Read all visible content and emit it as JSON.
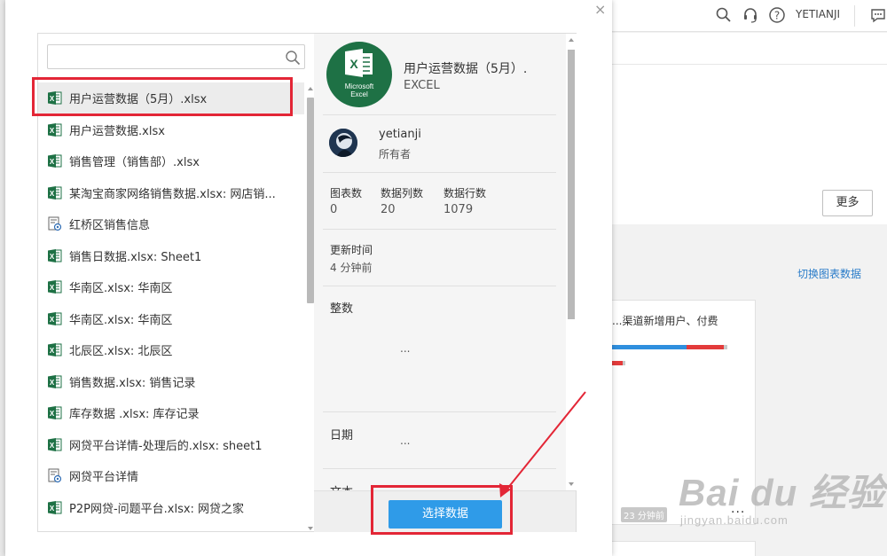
{
  "topbar": {
    "user_name": "YETIANJI",
    "icons": [
      "search-icon",
      "headset-icon",
      "help-icon",
      "chat-icon"
    ]
  },
  "background": {
    "more_button": "更多",
    "switch_link": "切换图表数据",
    "card_title": "渠道新增用户、付费...",
    "card_time": "23 分钟前",
    "card_more": "...",
    "watermark_logo": "Bai du 经验",
    "watermark_url": "jingyan.baidu.com"
  },
  "dialog": {
    "close_label": "×",
    "search": {
      "value": "",
      "placeholder": ""
    },
    "files": [
      {
        "name": "用户运营数据（5月）.xlsx",
        "icon": "excel-icon",
        "selected": true
      },
      {
        "name": "用户运营数据.xlsx",
        "icon": "excel-icon"
      },
      {
        "name": "销售管理（销售部）.xlsx",
        "icon": "excel-icon"
      },
      {
        "name": "某淘宝商家网络销售数据.xlsx: 网店销...",
        "icon": "excel-icon"
      },
      {
        "name": "红桥区销售信息",
        "icon": "database-icon"
      },
      {
        "name": "销售日数据.xlsx: Sheet1",
        "icon": "excel-icon"
      },
      {
        "name": "华南区.xlsx: 华南区",
        "icon": "excel-icon"
      },
      {
        "name": "华南区.xlsx: 华南区",
        "icon": "excel-icon"
      },
      {
        "name": "北辰区.xlsx: 北辰区",
        "icon": "excel-icon"
      },
      {
        "name": "销售数据.xlsx: 销售记录",
        "icon": "excel-icon"
      },
      {
        "name": "库存数据 .xlsx: 库存记录",
        "icon": "excel-icon"
      },
      {
        "name": "网贷平台详情-处理后的.xlsx: sheet1",
        "icon": "excel-icon"
      },
      {
        "name": "网贷平台详情",
        "icon": "database-icon"
      },
      {
        "name": "P2P网贷-问题平台.xlsx: 网贷之家",
        "icon": "excel-icon"
      }
    ],
    "detail": {
      "logo_text": [
        "Microsoft",
        "Excel"
      ],
      "file_title": "用户运营数据（5月）.",
      "file_type": "EXCEL",
      "owner_name": "yetianji",
      "owner_role": "所有者",
      "stats": [
        {
          "label": "图表数",
          "value": "0"
        },
        {
          "label": "数据列数",
          "value": "20"
        },
        {
          "label": "数据行数",
          "value": "1079"
        }
      ],
      "updated_label": "更新时间",
      "updated_value": "4 分钟前",
      "section_integer": "整数",
      "section_date": "日期",
      "section_text": "文本",
      "ellipsis": "..."
    },
    "select_button": "选择数据"
  },
  "colors": {
    "accent_blue": "#2f9be8",
    "excel_green": "#1e7145",
    "annotation_red": "#e32636",
    "link_blue": "#2a7cc9"
  }
}
